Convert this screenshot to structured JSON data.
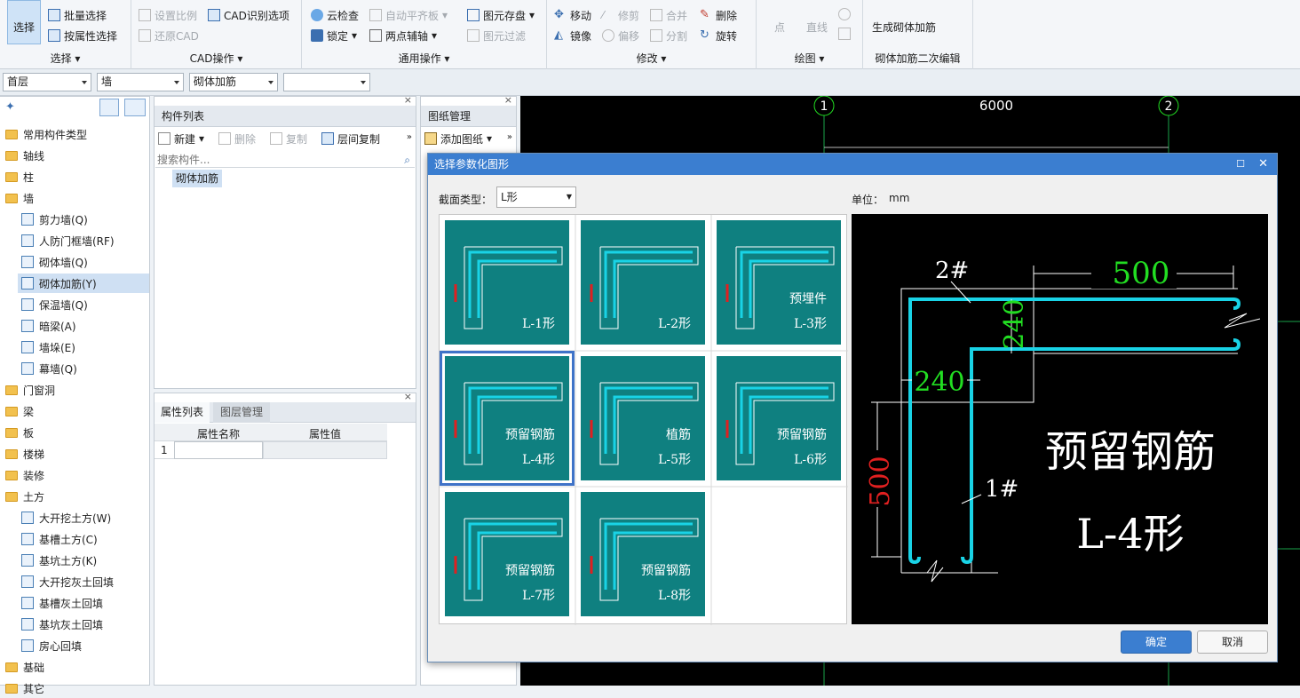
{
  "ribbon": {
    "groups": {
      "select": {
        "label": "选择",
        "select_btn": "选择",
        "batch": "批量选择",
        "by_attr": "按属性选择"
      },
      "cad": {
        "label": "CAD操作",
        "set_scale": "设置比例",
        "restore_cad": "还原CAD",
        "cad_options": "CAD识别选项"
      },
      "general": {
        "label": "通用操作",
        "cloud_check": "云检查",
        "lock": "锁定",
        "auto_align": "自动平齐板",
        "two_point_axis": "两点辅轴",
        "save_element": "图元存盘",
        "element_filter": "图元过滤"
      },
      "modify": {
        "label": "修改",
        "move": "移动",
        "mirror": "镜像",
        "trim": "修剪",
        "offset": "偏移",
        "merge": "合并",
        "split": "分割",
        "delete": "删除",
        "rotate": "旋转"
      },
      "draw": {
        "label": "绘图",
        "point": "点",
        "line": "直线"
      },
      "rebar": {
        "label": "砌体加筋二次编辑",
        "generate": "生成砌体加筋"
      }
    }
  },
  "combos": {
    "floor": "首层",
    "category": "墙",
    "type": "砌体加筋",
    "item": ""
  },
  "tree": {
    "items": [
      {
        "label": "常用构件类型",
        "level": 0
      },
      {
        "label": "轴线",
        "level": 0
      },
      {
        "label": "柱",
        "level": 0
      },
      {
        "label": "墙",
        "level": 0
      },
      {
        "label": "剪力墙(Q)",
        "level": 1
      },
      {
        "label": "人防门框墙(RF)",
        "level": 1
      },
      {
        "label": "砌体墙(Q)",
        "level": 1
      },
      {
        "label": "砌体加筋(Y)",
        "level": 1,
        "selected": true
      },
      {
        "label": "保温墙(Q)",
        "level": 1
      },
      {
        "label": "暗梁(A)",
        "level": 1
      },
      {
        "label": "墙垛(E)",
        "level": 1
      },
      {
        "label": "幕墙(Q)",
        "level": 1
      },
      {
        "label": "门窗洞",
        "level": 0
      },
      {
        "label": "梁",
        "level": 0
      },
      {
        "label": "板",
        "level": 0
      },
      {
        "label": "楼梯",
        "level": 0
      },
      {
        "label": "装修",
        "level": 0
      },
      {
        "label": "土方",
        "level": 0
      },
      {
        "label": "大开挖土方(W)",
        "level": 1
      },
      {
        "label": "基槽土方(C)",
        "level": 1
      },
      {
        "label": "基坑土方(K)",
        "level": 1
      },
      {
        "label": "大开挖灰土回填",
        "level": 1
      },
      {
        "label": "基槽灰土回填",
        "level": 1
      },
      {
        "label": "基坑灰土回填",
        "level": 1
      },
      {
        "label": "房心回填",
        "level": 1
      },
      {
        "label": "基础",
        "level": 0
      },
      {
        "label": "其它",
        "level": 0
      }
    ]
  },
  "component_list": {
    "title": "构件列表",
    "new": "新建",
    "delete": "删除",
    "copy": "复制",
    "floor_copy": "层间复制",
    "search_placeholder": "搜索构件...",
    "items": [
      "砌体加筋"
    ]
  },
  "drawing_mgmt": {
    "title": "图纸管理",
    "add": "添加图纸"
  },
  "props": {
    "tab1": "属性列表",
    "tab2": "图层管理",
    "col_name": "属性名称",
    "col_value": "属性值",
    "row1": "1"
  },
  "canvas": {
    "axis1": "1",
    "axis2": "2",
    "dim": "6000"
  },
  "dialog": {
    "title": "选择参数化图形",
    "section_label": "截面类型：",
    "section_value": "L形",
    "unit_label": "单位：",
    "unit_value": "mm",
    "ok": "确定",
    "cancel": "取消",
    "thumbs": [
      {
        "caption1": "",
        "caption2": "L-1形"
      },
      {
        "caption1": "",
        "caption2": "L-2形"
      },
      {
        "caption1": "预埋件",
        "caption2": "L-3形"
      },
      {
        "caption1": "预留钢筋",
        "caption2": "L-4形"
      },
      {
        "caption1": "植筋",
        "caption2": "L-5形"
      },
      {
        "caption1": "预留钢筋",
        "caption2": "L-6形"
      },
      {
        "caption1": "预留钢筋",
        "caption2": "L-7形"
      },
      {
        "caption1": "预留钢筋",
        "caption2": "L-8形"
      }
    ],
    "preview": {
      "label_2": "2#",
      "label_1": "1#",
      "dim_500_top": "500",
      "dim_240_v": "240",
      "dim_240_h": "240",
      "dim_500_left": "500",
      "title1": "预留钢筋",
      "title2": "L-4形"
    }
  },
  "colors": {
    "teal": "#0f8080",
    "rebar": "#19d3e6",
    "dim_green": "#22dd22",
    "dim_red": "#e02020",
    "accent": "#3b7ed0"
  }
}
